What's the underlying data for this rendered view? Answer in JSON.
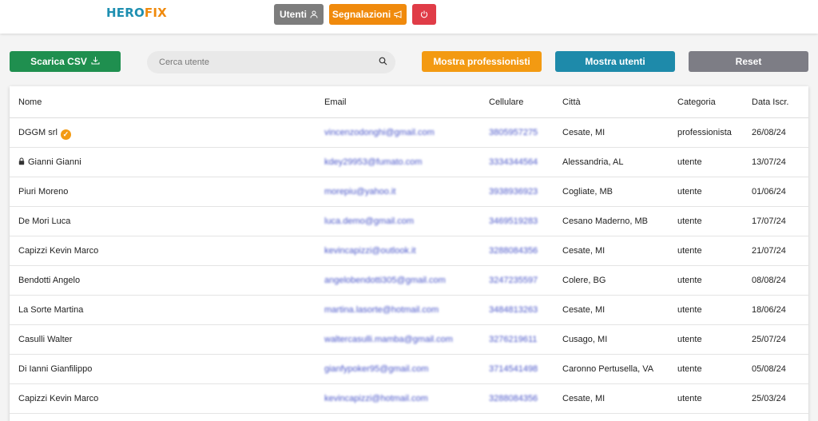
{
  "header": {
    "logo_part1": "HERO",
    "logo_part2": "FIX",
    "nav": {
      "utenti_label": "Utenti",
      "segnalazioni_label": "Segnalazioni"
    }
  },
  "toolbar": {
    "csv_label": "Scarica CSV",
    "search_placeholder": "Cerca utente",
    "show_professionals_label": "Mostra professionisti",
    "show_users_label": "Mostra utenti",
    "reset_label": "Reset"
  },
  "table": {
    "columns": {
      "nome": "Nome",
      "email": "Email",
      "cellulare": "Cellulare",
      "citta": "Città",
      "categoria": "Categoria",
      "data": "Data Iscr."
    },
    "rows": [
      {
        "nome": "DGGM srl",
        "email": "vincenzodonghi@gmail.com",
        "cellulare": "3805957275",
        "citta": "Cesate, MI",
        "categoria": "professionista",
        "data": "26/08/24"
      },
      {
        "nome": "Gianni Gianni",
        "email": "kdey29953@fumato.com",
        "cellulare": "3334344564",
        "citta": "Alessandria, AL",
        "categoria": "utente",
        "data": "13/07/24"
      },
      {
        "nome": "Piuri Moreno",
        "email": "morepiu@yahoo.it",
        "cellulare": "3938936923",
        "citta": "Cogliate, MB",
        "categoria": "utente",
        "data": "01/06/24"
      },
      {
        "nome": "De Mori Luca",
        "email": "luca.demo@gmail.com",
        "cellulare": "3469519283",
        "citta": "Cesano Maderno, MB",
        "categoria": "utente",
        "data": "17/07/24"
      },
      {
        "nome": "Capizzi Kevin Marco",
        "email": "kevincapizzi@outlook.it",
        "cellulare": "3288084356",
        "citta": "Cesate, MI",
        "categoria": "utente",
        "data": "21/07/24"
      },
      {
        "nome": "Bendotti Angelo",
        "email": "angelobendotti305@gmail.com",
        "cellulare": "3247235597",
        "citta": "Colere, BG",
        "categoria": "utente",
        "data": "08/08/24"
      },
      {
        "nome": "La Sorte Martina",
        "email": "martina.lasorte@hotmail.com",
        "cellulare": "3484813263",
        "citta": "Cesate, MI",
        "categoria": "utente",
        "data": "18/06/24"
      },
      {
        "nome": "Casulli Walter",
        "email": "waltercasulli.mamba@gmail.com",
        "cellulare": "3276219611",
        "citta": "Cusago, MI",
        "categoria": "utente",
        "data": "25/07/24"
      },
      {
        "nome": "Di Ianni Gianfilippo",
        "email": "gianfypoker95@gmail.com",
        "cellulare": "3714541498",
        "citta": "Caronno Pertusella, VA",
        "categoria": "utente",
        "data": "05/08/24"
      },
      {
        "nome": "Capizzi Kevin Marco",
        "email": "kevincapizzi@hotmail.com",
        "cellulare": "3288084356",
        "citta": "Cesate, MI",
        "categoria": "utente",
        "data": "25/03/24"
      }
    ]
  },
  "colors": {
    "brand_blue": "#1e8fb1",
    "brand_orange": "#f08a0c",
    "csv_green": "#1f8f4f",
    "power_red": "#e03c47",
    "link_blue": "#4a56c9"
  },
  "icons": {
    "utenti": "user-icon",
    "segnalazioni": "megaphone-icon",
    "power": "power-icon",
    "csv": "download-icon",
    "search": "search-icon",
    "verified": "verified-badge-icon",
    "lock": "lock-icon"
  }
}
